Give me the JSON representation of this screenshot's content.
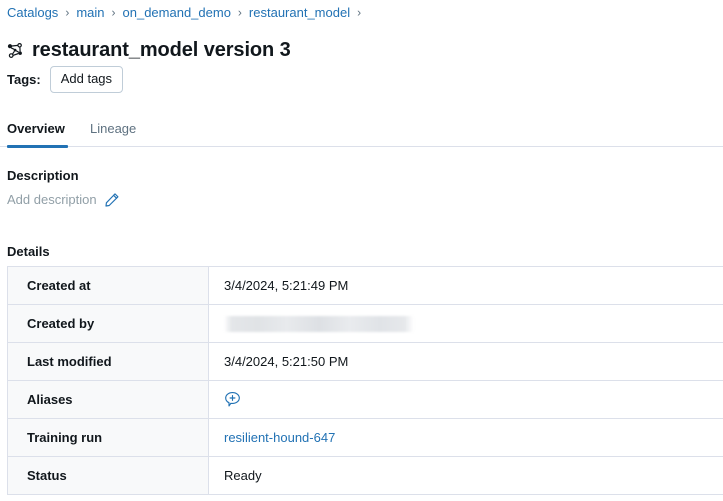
{
  "breadcrumb": {
    "separator": "›",
    "items": [
      {
        "label": "Catalogs"
      },
      {
        "label": "main"
      },
      {
        "label": "on_demand_demo"
      },
      {
        "label": "restaurant_model"
      }
    ],
    "trailing_separator": "›"
  },
  "header": {
    "icon": "model-graph-icon",
    "title": "restaurant_model version 3"
  },
  "tags": {
    "label": "Tags:",
    "add_button": "Add tags"
  },
  "tabs": {
    "items": [
      {
        "label": "Overview",
        "active": true
      },
      {
        "label": "Lineage",
        "active": false
      }
    ]
  },
  "description": {
    "heading": "Description",
    "placeholder": "Add description",
    "edit_icon": "pencil-icon"
  },
  "details": {
    "heading": "Details",
    "rows": [
      {
        "key": "Created at",
        "value": "3/4/2024, 5:21:49 PM",
        "type": "text"
      },
      {
        "key": "Created by",
        "value": "",
        "type": "redacted"
      },
      {
        "key": "Last modified",
        "value": "3/4/2024, 5:21:50 PM",
        "type": "text"
      },
      {
        "key": "Aliases",
        "value": "",
        "type": "icon",
        "icon": "add-alias-icon"
      },
      {
        "key": "Training run",
        "value": "resilient-hound-647",
        "type": "link"
      },
      {
        "key": "Status",
        "value": "Ready",
        "type": "text"
      }
    ]
  },
  "colors": {
    "link": "#2272B4",
    "accent": "#2272B4",
    "text": "#11171C",
    "muted": "#5F7281",
    "placeholder": "#919FA7",
    "border": "#DCE0EA",
    "row_header_bg": "#F8F9FA"
  }
}
